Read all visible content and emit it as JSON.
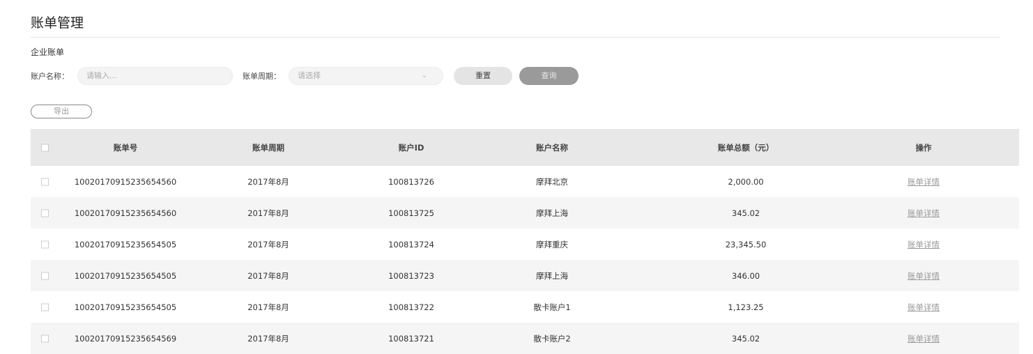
{
  "page_title": "账单管理",
  "section_title": "企业账单",
  "filters": {
    "account_name_label": "账户名称：",
    "account_name_placeholder": "请输入...",
    "period_label": "账单周期：",
    "period_placeholder": "请选择",
    "reset_label": "重置",
    "query_label": "查询"
  },
  "export_label": "导出",
  "table": {
    "headers": [
      "账单号",
      "账单周期",
      "账户ID",
      "账户名称",
      "账单总额（元）",
      "操作"
    ],
    "rows": [
      {
        "bill_no": "1002017091523565456​0",
        "period": "2017年8月",
        "account_id": "100813726",
        "account_name": "摩拜北京",
        "amount": "2,000.00",
        "action": "账单详情"
      },
      {
        "bill_no": "10020170915235654560",
        "period": "2017年8月",
        "account_id": "100813725",
        "account_name": "摩拜上海",
        "amount": "345.02",
        "action": "账单详情"
      },
      {
        "bill_no": "10020170915235654505",
        "period": "2017年8月",
        "account_id": "100813724",
        "account_name": "摩拜重庆",
        "amount": "23,345.50",
        "action": "账单详情"
      },
      {
        "bill_no": "10020170915235654505",
        "period": "2017年8月",
        "account_id": "100813723",
        "account_name": "摩拜上海",
        "amount": "346.00",
        "action": "账单详情"
      },
      {
        "bill_no": "10020170915235654505",
        "period": "2017年8月",
        "account_id": "100813722",
        "account_name": "散卡账户1",
        "amount": "1,123.25",
        "action": "账单详情"
      },
      {
        "bill_no": "10020170915235654569",
        "period": "2017年8月",
        "account_id": "100813721",
        "account_name": "散卡账户2",
        "amount": "345.02",
        "action": "账单详情"
      }
    ]
  }
}
